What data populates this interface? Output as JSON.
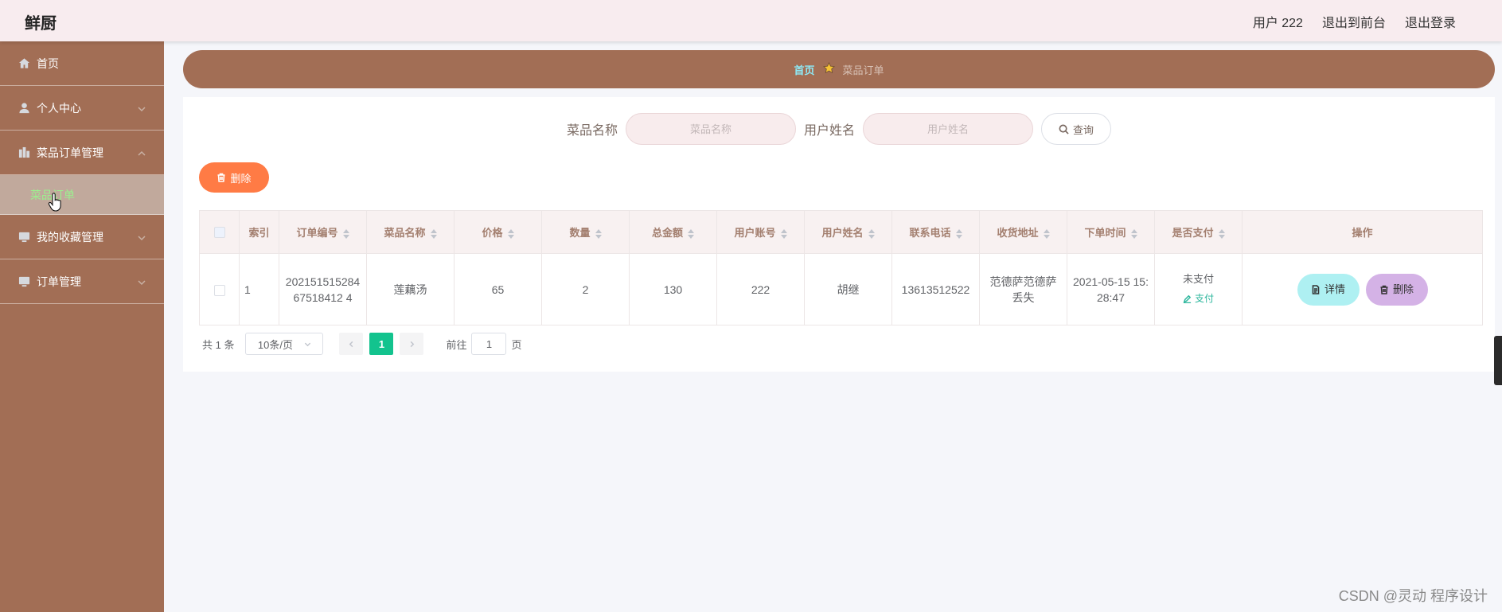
{
  "header": {
    "brand": "鲜厨",
    "user_label": "用户 222",
    "back_front": "退出到前台",
    "logout": "退出登录"
  },
  "sidebar": {
    "items": [
      {
        "label": "首页",
        "icon": "home-icon"
      },
      {
        "label": "个人中心",
        "icon": "user-icon"
      },
      {
        "label": "菜品订单管理",
        "icon": "grid-icon"
      },
      {
        "label": "我的收藏管理",
        "icon": "monitor-icon"
      },
      {
        "label": "订单管理",
        "icon": "monitor-icon"
      }
    ],
    "submenu_active": "菜品订单"
  },
  "breadcrumb": {
    "home": "首页",
    "current": "菜品订单"
  },
  "search": {
    "dish_label": "菜品名称",
    "dish_placeholder": "菜品名称",
    "user_label": "用户姓名",
    "user_placeholder": "用户姓名",
    "query_button": "查询"
  },
  "toolbar": {
    "delete_label": "删除"
  },
  "table": {
    "headers": [
      "索引",
      "订单编号",
      "菜品名称",
      "价格",
      "数量",
      "总金额",
      "用户账号",
      "用户姓名",
      "联系电话",
      "收货地址",
      "下单时间",
      "是否支付",
      "操作"
    ],
    "rows": [
      {
        "index": "1",
        "order_no": "20215151528467518412 4",
        "dish": "莲藕汤",
        "price": "65",
        "qty": "2",
        "total": "130",
        "account": "222",
        "name": "胡继",
        "phone": "13613512522",
        "address": "范德萨范德萨丢失",
        "time": "2021-05-15 15:28:47",
        "pay_status": "未支付",
        "pay_link": "支付",
        "detail_btn": "详情",
        "delete_btn": "删除"
      }
    ]
  },
  "pagination": {
    "total": "共 1 条",
    "page_size": "10条/页",
    "current_page": "1",
    "goto_label": "前往",
    "goto_value": "1",
    "page_suffix": "页"
  },
  "watermark": "CSDN @灵动 程序设计",
  "colors": {
    "sidebar": "#a26e55",
    "header": "#f8ecef",
    "accent_green": "#13c38e",
    "delete_orange": "#ff7b45",
    "detail_cyan": "#aef0f2",
    "delete_purple": "#d4b2e6"
  }
}
